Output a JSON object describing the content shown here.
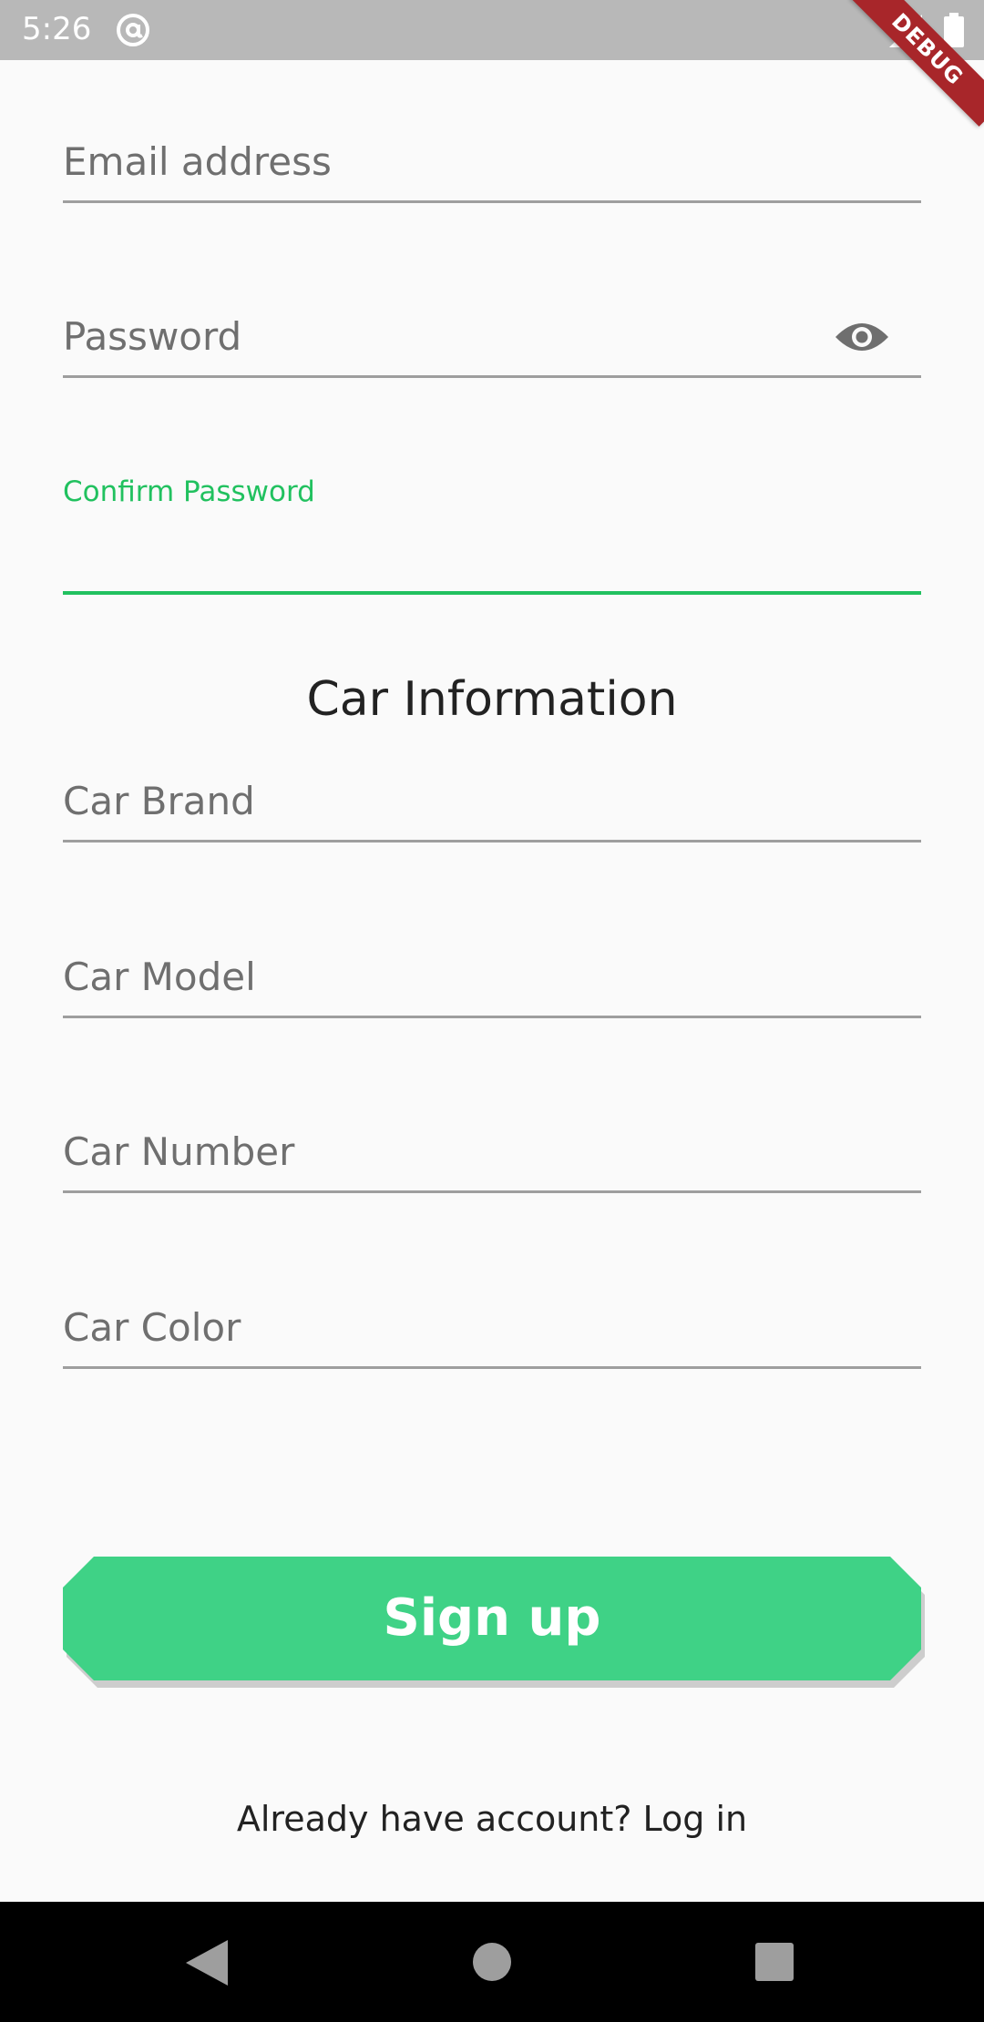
{
  "status_bar": {
    "time": "5:26",
    "icons": [
      "at-sign-icon",
      "signal-icon",
      "battery-icon"
    ]
  },
  "debug_banner": "DEBUG",
  "form": {
    "email_label": "Email address",
    "password_label": "Password",
    "confirm_password_label": "Confirm Password",
    "section_title": "Car Information",
    "car_brand_label": "Car Brand",
    "car_model_label": "Car Model",
    "car_number_label": "Car Number",
    "car_color_label": "Car Color"
  },
  "actions": {
    "signup_label": "Sign up",
    "login_link": "Already have account? Log in"
  },
  "colors": {
    "accent": "#21c15f",
    "button": "#3fd286",
    "status_bar": "#b8b8b8",
    "nav_bar": "#000000",
    "debug_ribbon": "#a8262a"
  }
}
